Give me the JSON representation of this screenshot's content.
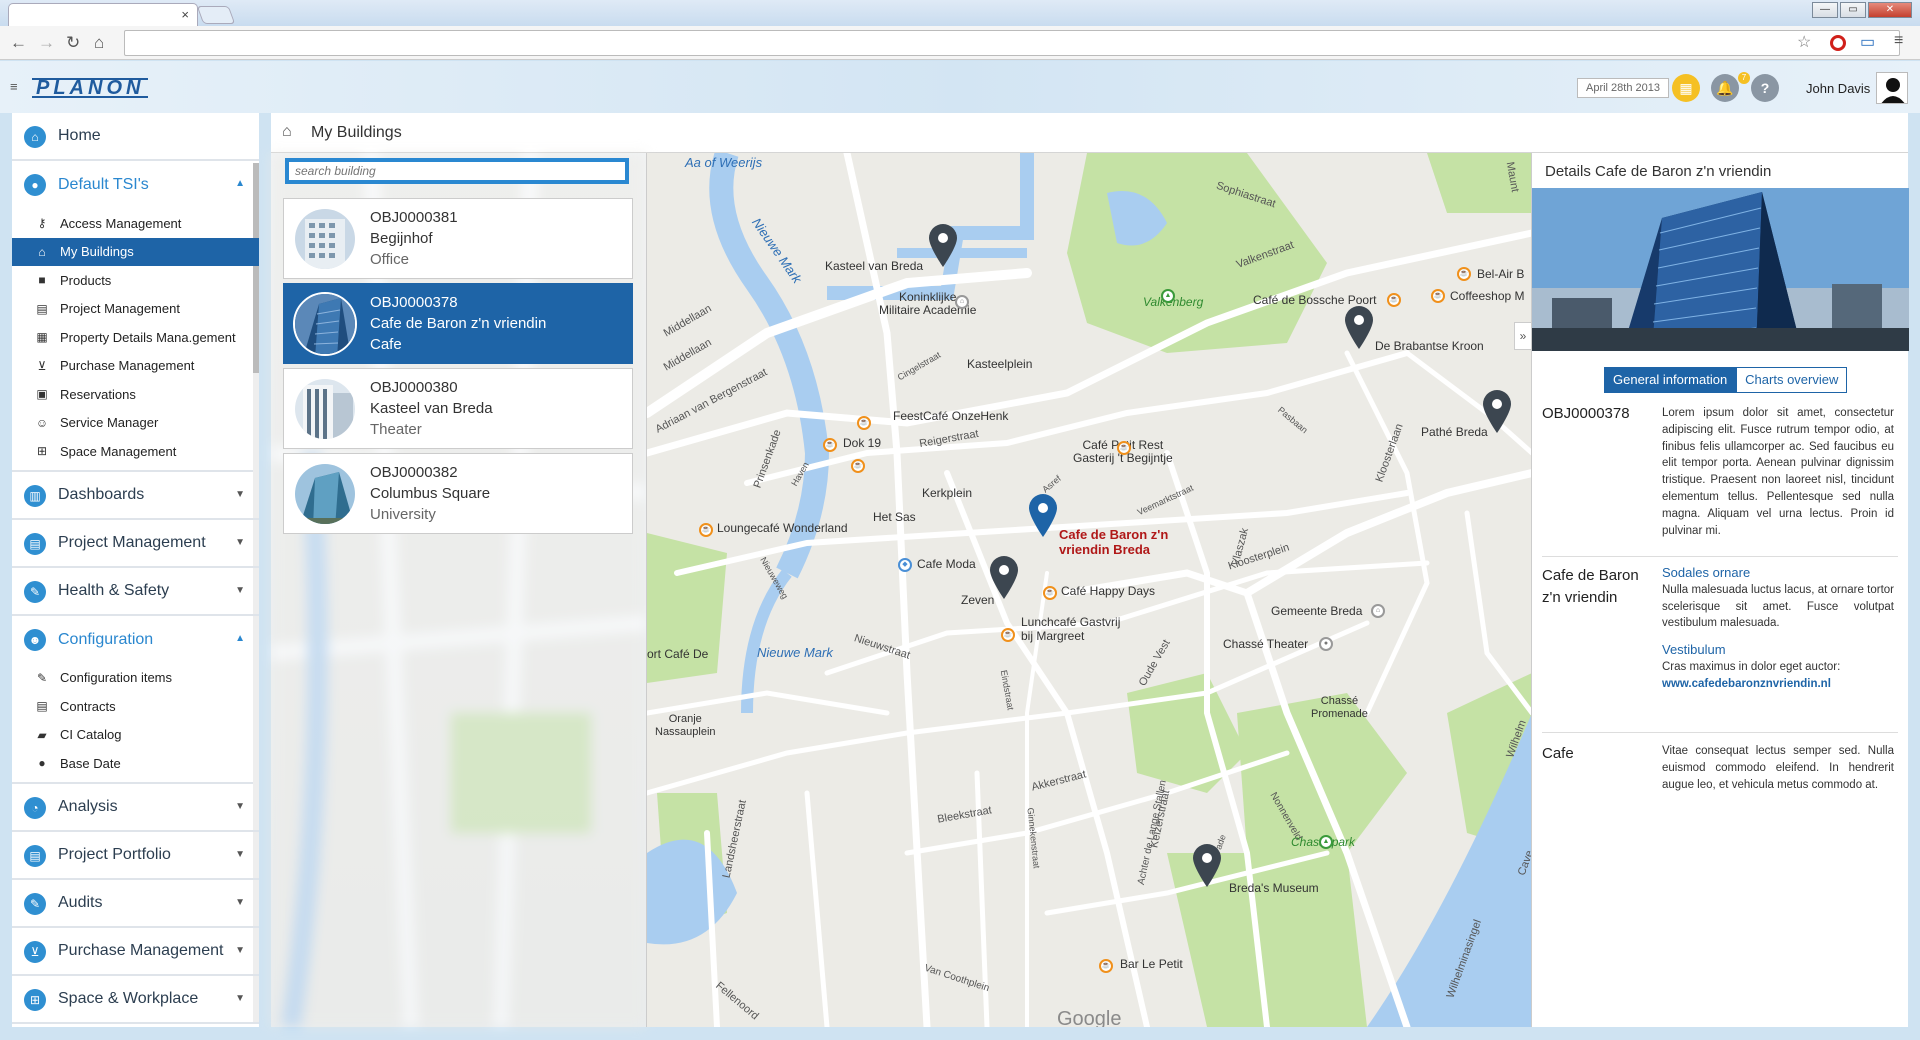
{
  "browser": {
    "tab_close": "×",
    "win_min": "—",
    "win_max": "▭",
    "win_close": "✕",
    "nav_back": "←",
    "nav_forward": "→",
    "nav_reload": "↻",
    "nav_home": "⌂",
    "url": ""
  },
  "header": {
    "logo": "PLANON",
    "date": "April 28th 2013",
    "notifications_count": "7",
    "help": "?",
    "user_name": "John Davis"
  },
  "sidebar": {
    "home": "Home",
    "default_tsis": {
      "label": "Default TSI's",
      "items": [
        "Access Management",
        "My Buildings",
        "Products",
        "Project Management",
        "Property Details Mana.gement",
        "Purchase Management",
        "Reservations",
        "Service Manager",
        "Space Management"
      ]
    },
    "dashboards": "Dashboards",
    "project_management": "Project Management",
    "health_safety": "Health & Safety",
    "configuration": {
      "label": "Configuration",
      "items": [
        "Configuration items",
        "Contracts",
        "CI Catalog",
        "Base Date"
      ]
    },
    "analysis": "Analysis",
    "project_portfolio": "Project Portfolio",
    "audits": "Audits",
    "purchase_management": "Purchase Management",
    "space_workplace": "Space & Workplace"
  },
  "main": {
    "title": "My Buildings",
    "search_placeholder": "search building"
  },
  "buildings": [
    {
      "id": "OBJ0000381",
      "name": "Begijnhof",
      "type": "Office"
    },
    {
      "id": "OBJ0000378",
      "name": "Cafe de Baron z'n vriendin",
      "type": "Cafe"
    },
    {
      "id": "OBJ0000380",
      "name": "Kasteel van Breda",
      "type": "Theater"
    },
    {
      "id": "OBJ0000382",
      "name": "Columbus Square",
      "type": "University"
    }
  ],
  "map": {
    "labels": {
      "aa_of_weerijs": "Aa of Weerijs",
      "sophiastraat": "Sophiastraat",
      "maunt": "Maunt",
      "nieuwe_mark_1": "Nieuwe Mark",
      "kasteel": "Kasteel van Breda",
      "kmaa": "Koninklijke\nMilitaire Academie",
      "valkenberg": "Valkenberg",
      "valkenstraat": "Valkenstraat",
      "belair": "Bel-Air B",
      "coffeeshop": "Coffeeshop M",
      "cafe_bossche": "Café de Bossche Poort",
      "brabantse": "De Brabantse Kroon",
      "middellaan1": "Middellaan",
      "middellaan2": "Middellaan",
      "adriaan": "Adriaan van Bergenstraat",
      "cingelstraat": "Cingelstraat",
      "kasteelplein": "Kasteelplein",
      "feestcafe": "FeestCafé OnzeHenk",
      "prinsenkade": "Prinsenkade",
      "dok19": "Dok 19",
      "reigerstraat": "Reigerstraat",
      "haven": "Haven",
      "pasbaan": "Pasbaan",
      "petit_rest": "Café Petit Rest\nGasterij 't Begijntje",
      "pathe": "Pathé Breda",
      "kloosterlaan": "Kloosterlaan",
      "kerkplein": "Kerkplein",
      "hetsas": "Het Sas",
      "veemarkt": "Veemarktstraat",
      "loungecafe": "Loungecafé Wonderland",
      "asref": "Asref",
      "cafe_baron": "Cafe de Baron z'n\nvriendin Breda",
      "nieuweweg": "Nieuweweg",
      "cafe_moda": "Cafe Moda",
      "vlaszak": "Vlaszak",
      "kloosterplein": "Kloosterplein",
      "zeven": "Zeven",
      "happy_days": "Café Happy Days",
      "gemeente": "Gemeente Breda",
      "lunchcafe": "Lunchcafé Gastvrij\nbij Margreet",
      "nieuwstraat": "Nieuwstraat",
      "cafe_de": "ort Café De",
      "nieuwe_mark_2": "Nieuwe Mark",
      "chasse_theater": "Chassé Theater",
      "oude_vest": "Oude Vest",
      "eindstraat": "Eindstraat",
      "chasse_promenade": "Chassé\nPromenade",
      "oranje": "Oranje\nNassauplein",
      "akkerstraat": "Akkerstraat",
      "landsheer": "Landsheerstraat",
      "bleekstraat": "Bleekstraat",
      "ginnekenstraat": "Ginnekenstraat",
      "achter_lange": "Achter de Lange Stallen",
      "keizerstraat": "Keizerstraat",
      "nonnenveld": "Nonnenveld",
      "chasse_park": "Chassépark",
      "bredas_museum": "Breda's Museum",
      "markstraat": "straat",
      "bar_le_petit": "Bar Le Petit",
      "van_coothplein": "Van Coothplein",
      "fellenoord": "Fellenoord",
      "google": "Google",
      "wilhelmina": "Wilhelminasingel",
      "wilhelm": "Wilhelm",
      "cave": "Cave",
      "mark": "ade"
    },
    "collapse": "»"
  },
  "details": {
    "title": "Details Cafe de Baron z'n vriendin",
    "tabs": [
      "General information",
      "Charts overview"
    ],
    "id": "OBJ0000378",
    "intro": "Lorem ipsum dolor sit amet, consectetur adipiscing elit. Fusce rutrum tempor odio, at finibus felis ullamcorper ac. Sed faucibus eu elit tempor porta. Aenean pulvinar dignissim tristique. Praesent non laoreet nisl, tincidunt elementum tellus. Pellentesque sed nulla magna. Aliquam vel urna lectus. Proin id pulvinar mi.",
    "name": "Cafe de Baron z'n vriendin",
    "sodales_heading": "Sodales ornare",
    "sodales_text": "Nulla malesuada luctus lacus, at ornare tortor scelerisque sit amet. Fusce volutpat vestibulum malesuada.",
    "vestibulum_heading": "Vestibulum",
    "vestibulum_text": "Cras maximus in dolor eget auctor:",
    "website": "www.cafedebaronznvriendin.nl",
    "type": "Cafe",
    "type_text": "Vitae consequat lectus semper sed. Nulla euismod commodo eleifend. In hendrerit augue leo, et vehicula metus commodo at."
  },
  "colors": {
    "primary": "#1e64a7",
    "accent": "#2a88d1",
    "map_water": "#a9cdf0",
    "map_park": "#c5e2a5",
    "poi": "#f0901b"
  }
}
